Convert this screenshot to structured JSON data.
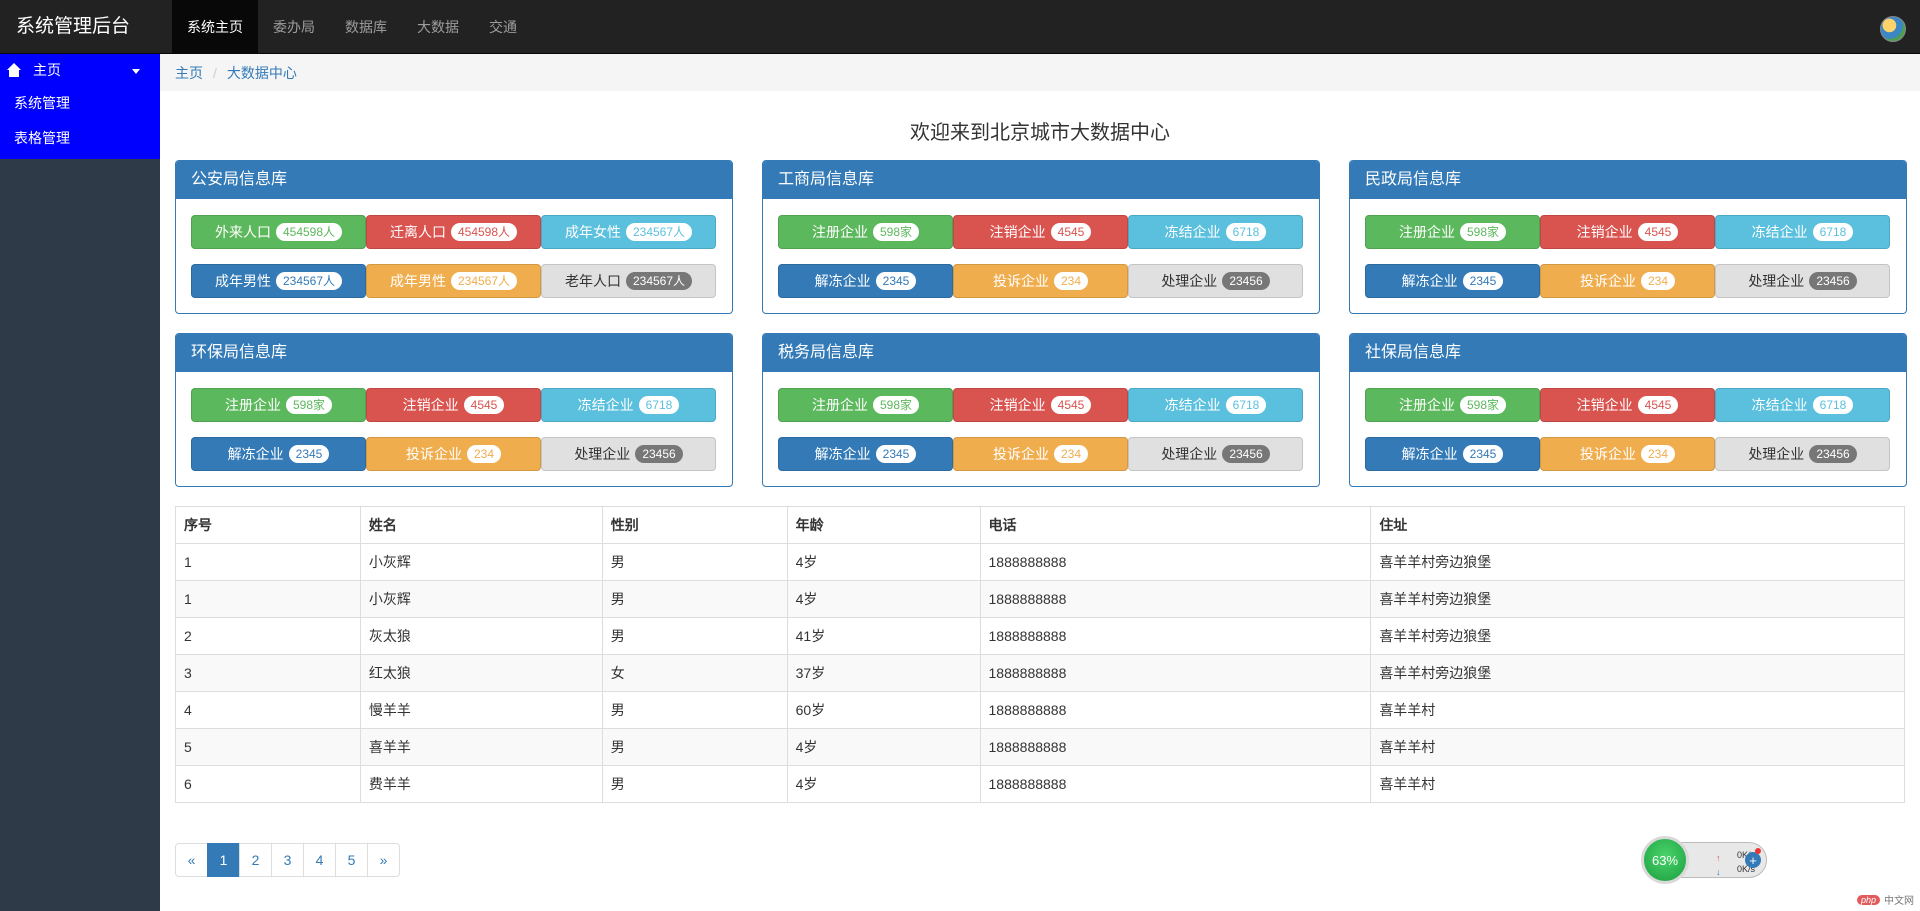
{
  "app": {
    "title": "系统管理后台"
  },
  "topnav": {
    "items": [
      {
        "label": "系统主页",
        "active": true
      },
      {
        "label": "委办局"
      },
      {
        "label": "数据库"
      },
      {
        "label": "大数据"
      },
      {
        "label": "交通"
      }
    ]
  },
  "sidebar": {
    "header": "主页",
    "items": [
      {
        "label": "系统管理"
      },
      {
        "label": "表格管理"
      }
    ]
  },
  "breadcrumb": [
    "主页",
    "大数据中心"
  ],
  "page_title": "欢迎来到北京城市大数据中心",
  "panels": [
    {
      "title": "公安局信息库",
      "buttons": [
        {
          "label": "外来人口",
          "badge": "454598人",
          "style": "success"
        },
        {
          "label": "迁离人口",
          "badge": "454598人",
          "style": "danger"
        },
        {
          "label": "成年女性",
          "badge": "234567人",
          "style": "info"
        },
        {
          "label": "成年男性",
          "badge": "234567人",
          "style": "primary"
        },
        {
          "label": "成年男性",
          "badge": "234567人",
          "style": "warning"
        },
        {
          "label": "老年人口",
          "badge": "234567人",
          "style": "default"
        }
      ]
    },
    {
      "title": "工商局信息库",
      "buttons": [
        {
          "label": "注册企业",
          "badge": "598家",
          "style": "success"
        },
        {
          "label": "注销企业",
          "badge": "4545",
          "style": "danger"
        },
        {
          "label": "冻结企业",
          "badge": "6718",
          "style": "info"
        },
        {
          "label": "解冻企业",
          "badge": "2345",
          "style": "primary"
        },
        {
          "label": "投诉企业",
          "badge": "234",
          "style": "warning"
        },
        {
          "label": "处理企业",
          "badge": "23456",
          "style": "default"
        }
      ]
    },
    {
      "title": "民政局信息库",
      "buttons": [
        {
          "label": "注册企业",
          "badge": "598家",
          "style": "success"
        },
        {
          "label": "注销企业",
          "badge": "4545",
          "style": "danger"
        },
        {
          "label": "冻结企业",
          "badge": "6718",
          "style": "info"
        },
        {
          "label": "解冻企业",
          "badge": "2345",
          "style": "primary"
        },
        {
          "label": "投诉企业",
          "badge": "234",
          "style": "warning"
        },
        {
          "label": "处理企业",
          "badge": "23456",
          "style": "default"
        }
      ]
    },
    {
      "title": "环保局信息库",
      "buttons": [
        {
          "label": "注册企业",
          "badge": "598家",
          "style": "success"
        },
        {
          "label": "注销企业",
          "badge": "4545",
          "style": "danger"
        },
        {
          "label": "冻结企业",
          "badge": "6718",
          "style": "info"
        },
        {
          "label": "解冻企业",
          "badge": "2345",
          "style": "primary"
        },
        {
          "label": "投诉企业",
          "badge": "234",
          "style": "warning"
        },
        {
          "label": "处理企业",
          "badge": "23456",
          "style": "default"
        }
      ]
    },
    {
      "title": "税务局信息库",
      "buttons": [
        {
          "label": "注册企业",
          "badge": "598家",
          "style": "success"
        },
        {
          "label": "注销企业",
          "badge": "4545",
          "style": "danger"
        },
        {
          "label": "冻结企业",
          "badge": "6718",
          "style": "info"
        },
        {
          "label": "解冻企业",
          "badge": "2345",
          "style": "primary"
        },
        {
          "label": "投诉企业",
          "badge": "234",
          "style": "warning"
        },
        {
          "label": "处理企业",
          "badge": "23456",
          "style": "default"
        }
      ]
    },
    {
      "title": "社保局信息库",
      "buttons": [
        {
          "label": "注册企业",
          "badge": "598家",
          "style": "success"
        },
        {
          "label": "注销企业",
          "badge": "4545",
          "style": "danger"
        },
        {
          "label": "冻结企业",
          "badge": "6718",
          "style": "info"
        },
        {
          "label": "解冻企业",
          "badge": "2345",
          "style": "primary"
        },
        {
          "label": "投诉企业",
          "badge": "234",
          "style": "warning"
        },
        {
          "label": "处理企业",
          "badge": "23456",
          "style": "default"
        }
      ]
    }
  ],
  "table": {
    "columns": [
      "序号",
      "姓名",
      "性别",
      "年龄",
      "电话",
      "住址"
    ],
    "rows": [
      [
        "1",
        "小灰辉",
        "男",
        "4岁",
        "1888888888",
        "喜羊羊村旁边狼堡"
      ],
      [
        "1",
        "小灰辉",
        "男",
        "4岁",
        "1888888888",
        "喜羊羊村旁边狼堡"
      ],
      [
        "2",
        "灰太狼",
        "男",
        "41岁",
        "1888888888",
        "喜羊羊村旁边狼堡"
      ],
      [
        "3",
        "红太狼",
        "女",
        "37岁",
        "1888888888",
        "喜羊羊村旁边狼堡"
      ],
      [
        "4",
        "慢羊羊",
        "男",
        "60岁",
        "1888888888",
        "喜羊羊村"
      ],
      [
        "5",
        "喜羊羊",
        "男",
        "4岁",
        "1888888888",
        "喜羊羊村"
      ],
      [
        "6",
        "费羊羊",
        "男",
        "4岁",
        "1888888888",
        "喜羊羊村"
      ]
    ]
  },
  "pagination": {
    "items": [
      "«",
      "1",
      "2",
      "3",
      "4",
      "5",
      "»"
    ],
    "active": "1"
  },
  "speed_widget": {
    "percent": "63%",
    "upload": "0K/s",
    "download": "0K/s"
  },
  "watermark": {
    "logo": "php",
    "text": "中文网"
  },
  "colors": {
    "navbar": "#222222",
    "sidebar_active": "#0000ff",
    "sidebar": "#2f3a49",
    "primary": "#337ab7"
  }
}
